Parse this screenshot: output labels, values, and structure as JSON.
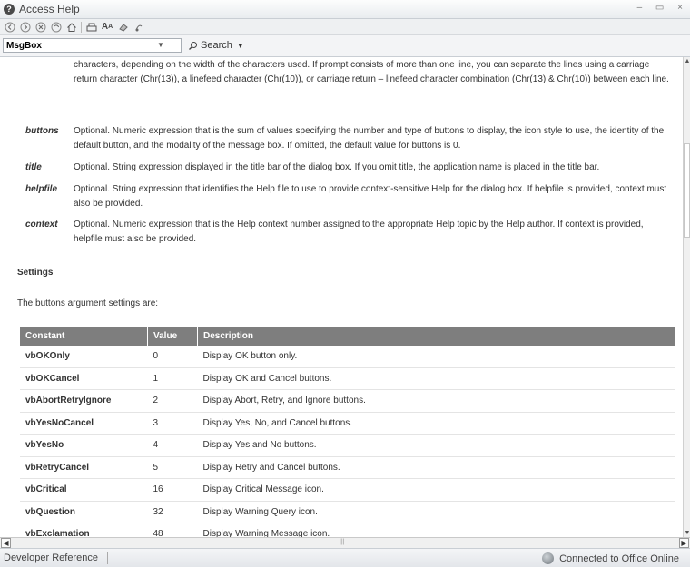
{
  "window": {
    "title": "Access Help",
    "controls": "– ▭ ×"
  },
  "toolbar": {
    "buttons": [
      "back-icon",
      "forward-icon",
      "stop-icon",
      "refresh-icon",
      "home-icon",
      "print-icon",
      "text-size-icon",
      "keep-on-top-icon",
      "toc-icon"
    ]
  },
  "search": {
    "value": "MsgBox",
    "button_label": "Search"
  },
  "params": {
    "continuation": "characters, depending on the width of the characters used. If prompt consists of more than one line, you can separate the lines using a carriage return character (Chr(13)), a linefeed character (Chr(10)), or carriage return – linefeed character combination (Chr(13) & Chr(10)) between each line.",
    "items": [
      {
        "name": "buttons",
        "desc": "Optional. Numeric expression that is the sum of values specifying the number and type of buttons to display, the icon style to use, the identity of the default button, and the modality of the message box. If omitted, the default value for buttons is 0."
      },
      {
        "name": "title",
        "desc": "Optional. String expression displayed in the title bar of the dialog box. If you omit title, the application name is placed in the title bar."
      },
      {
        "name": "helpfile",
        "desc": "Optional. String expression that identifies the Help file to use to provide context-sensitive Help for the dialog box. If helpfile is provided, context must also be provided."
      },
      {
        "name": "context",
        "desc": "Optional. Numeric expression that is the Help context number assigned to the appropriate Help topic by the Help author. If context is provided, helpfile must also be provided."
      }
    ]
  },
  "settings": {
    "heading": "Settings",
    "intro": "The buttons argument settings are:"
  },
  "table": {
    "headers": [
      "Constant",
      "Value",
      "Description"
    ],
    "rows": [
      [
        "vbOKOnly",
        "0",
        "Display OK button only."
      ],
      [
        "vbOKCancel",
        "1",
        "Display OK and Cancel buttons."
      ],
      [
        "vbAbortRetryIgnore",
        "2",
        "Display Abort, Retry, and Ignore buttons."
      ],
      [
        "vbYesNoCancel",
        "3",
        "Display Yes, No, and Cancel buttons."
      ],
      [
        "vbYesNo",
        "4",
        "Display Yes and No buttons."
      ],
      [
        "vbRetryCancel",
        "5",
        "Display Retry and Cancel buttons."
      ],
      [
        "vbCritical",
        "16",
        "Display Critical Message icon."
      ],
      [
        "vbQuestion",
        "32",
        "Display Warning Query icon."
      ],
      [
        "vbExclamation",
        "48",
        "Display Warning Message icon."
      ]
    ]
  },
  "statusbar": {
    "left": "Developer Reference",
    "right": "Connected to Office Online"
  }
}
